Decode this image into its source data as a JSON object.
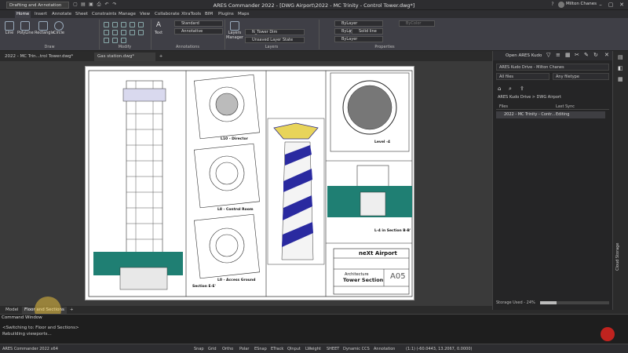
{
  "titlebar": {
    "workspace": "Drafting and Annotation",
    "title": "ARES Commander 2022 - [DWG Airport\\2022 - MC Trinity - Control Tower.dwg*]",
    "user": "Milton Chanes"
  },
  "menu": [
    "Home",
    "Insert",
    "Annotate",
    "Sheet",
    "Constraints",
    "Manage",
    "View",
    "Collaborate",
    "XtraTools",
    "BIM",
    "Plugins",
    "Maps"
  ],
  "ribbon": {
    "draw_buttons": [
      "Line",
      "PolyLine",
      "Rectangle",
      "Circle"
    ],
    "groups": {
      "draw": "Draw",
      "modify": "Modify",
      "annotations": "Annotations",
      "layers": "Layers",
      "properties": "Properties"
    },
    "text_style": "Standard",
    "dim_style": "Annotative",
    "layer_current": "N_Tower Dim",
    "layer_state": "Unsaved Layer State",
    "layers_manager": "Layers Manager",
    "text_btn": "Text",
    "color": "ByLayer",
    "linetype_layer": "ByLayer",
    "linetype": "Solid line",
    "lineweight": "ByLayer",
    "plot_style": "ByColor"
  },
  "doc_tabs": [
    "2022 - MC Trin...trol Tower.dwg*",
    "Gas station.dwg*"
  ],
  "layout_tabs": [
    "Model",
    "Floor and Sections"
  ],
  "drawing": {
    "labels": {
      "l10": "L10 - Director",
      "l8": "L8 - Control Room",
      "l0": "L0 - Access Ground",
      "section": "Section E-E'",
      "level": "Level -4",
      "l4": "L-4 in Section B-B'"
    },
    "title_block": {
      "project": "neXt Airport",
      "architecture": "Architecture",
      "sheet_title": "Tower Section",
      "sheet_number": "A05"
    }
  },
  "panel": {
    "header": "Open ARES Kudo",
    "drive": "ARES Kudo Drive - Milton Chanes",
    "filter_all": "All files",
    "filter_type": "Any filetype",
    "breadcrumb": "ARES Kudo Drive > DWG Airport",
    "col_files": "Files",
    "col_sync": "Last Sync",
    "file_name": "2022 - MC Trinity - Contr...",
    "file_status": "Editing",
    "storage": "Storage Used - 24%",
    "storage_pct": 0.24,
    "side_label": "Cloud Storage"
  },
  "command": {
    "header": "Command Window",
    "lines": [
      "<Switching to: Floor and Sections>",
      "Rebuilding viewports..."
    ]
  },
  "status": {
    "app": "ARES Commander 2022 x64",
    "toggles": [
      "Snap",
      "Grid",
      "Ortho",
      "Polar",
      "ESnap",
      "ETrack",
      "QInput",
      "LWeight",
      "SHEET",
      "Dynamic CCS",
      "Annotation"
    ],
    "coords": "(1:1) (-60.0443, 13.2067, 0.0000)"
  }
}
